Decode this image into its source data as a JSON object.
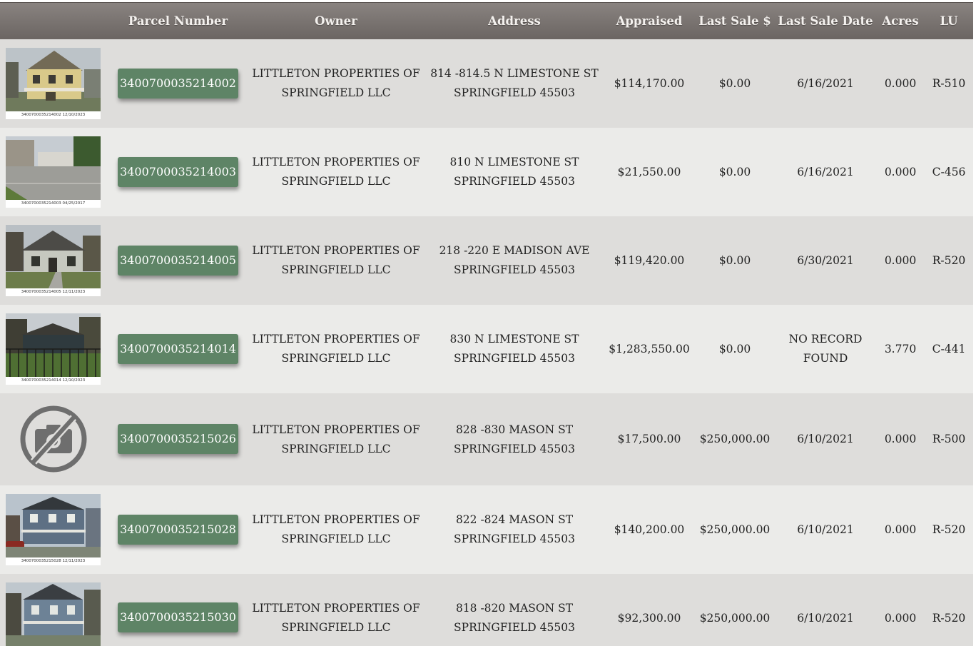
{
  "columns": {
    "parcel": "Parcel Number",
    "owner": "Owner",
    "address": "Address",
    "appraised": "Appraised",
    "last_sale": "Last Sale $",
    "last_sale_date": "Last Sale Date",
    "acres": "Acres",
    "lu": "LU"
  },
  "rows": [
    {
      "photo_caption": "3400700035214002 12/10/2023",
      "parcel": "3400700035214002",
      "owner_line1": "LITTLETON PROPERTIES OF",
      "owner_line2": "SPRINGFIELD LLC",
      "address_line1": "814 -814.5 N LIMESTONE ST",
      "address_line2": "SPRINGFIELD 45503",
      "appraised": "$114,170.00",
      "last_sale": "$0.00",
      "date_line1": "6/16/2021",
      "date_line2": "",
      "acres": "0.000",
      "lu": "R-510"
    },
    {
      "photo_caption": "3400700035214003 04/25/2017",
      "parcel": "3400700035214003",
      "owner_line1": "LITTLETON PROPERTIES OF",
      "owner_line2": "SPRINGFIELD LLC",
      "address_line1": "810 N LIMESTONE ST",
      "address_line2": "SPRINGFIELD 45503",
      "appraised": "$21,550.00",
      "last_sale": "$0.00",
      "date_line1": "6/16/2021",
      "date_line2": "",
      "acres": "0.000",
      "lu": "C-456"
    },
    {
      "photo_caption": "3400700035214005 12/11/2023",
      "parcel": "3400700035214005",
      "owner_line1": "LITTLETON PROPERTIES OF",
      "owner_line2": "SPRINGFIELD LLC",
      "address_line1": "218 -220 E MADISON AVE",
      "address_line2": "SPRINGFIELD 45503",
      "appraised": "$119,420.00",
      "last_sale": "$0.00",
      "date_line1": "6/30/2021",
      "date_line2": "",
      "acres": "0.000",
      "lu": "R-520"
    },
    {
      "photo_caption": "3400700035214014 12/10/2023",
      "parcel": "3400700035214014",
      "owner_line1": "LITTLETON PROPERTIES OF",
      "owner_line2": "SPRINGFIELD LLC",
      "address_line1": "830 N LIMESTONE ST",
      "address_line2": "SPRINGFIELD 45503",
      "appraised": "$1,283,550.00",
      "last_sale": "$0.00",
      "date_line1": "NO RECORD",
      "date_line2": "FOUND",
      "acres": "3.770",
      "lu": "C-441"
    },
    {
      "photo_caption": "",
      "parcel": "3400700035215026",
      "owner_line1": "LITTLETON PROPERTIES OF",
      "owner_line2": "SPRINGFIELD LLC",
      "address_line1": "828 -830 MASON ST",
      "address_line2": "SPRINGFIELD 45503",
      "appraised": "$17,500.00",
      "last_sale": "$250,000.00",
      "date_line1": "6/10/2021",
      "date_line2": "",
      "acres": "0.000",
      "lu": "R-500"
    },
    {
      "photo_caption": "3400700035215028 12/11/2023",
      "parcel": "3400700035215028",
      "owner_line1": "LITTLETON PROPERTIES OF",
      "owner_line2": "SPRINGFIELD LLC",
      "address_line1": "822 -824 MASON ST",
      "address_line2": "SPRINGFIELD 45503",
      "appraised": "$140,200.00",
      "last_sale": "$250,000.00",
      "date_line1": "6/10/2021",
      "date_line2": "",
      "acres": "0.000",
      "lu": "R-520"
    },
    {
      "photo_caption": "",
      "parcel": "3400700035215030",
      "owner_line1": "LITTLETON PROPERTIES OF",
      "owner_line2": "SPRINGFIELD LLC",
      "address_line1": "818 -820 MASON ST",
      "address_line2": "SPRINGFIELD 45503",
      "appraised": "$92,300.00",
      "last_sale": "$250,000.00",
      "date_line1": "6/10/2021",
      "date_line2": "",
      "acres": "0.000",
      "lu": "R-520"
    }
  ],
  "colors": {
    "header": "#7a7471",
    "row_dark": "#dedddb",
    "row_light": "#ebebe9",
    "parcel_button": "#5e8466"
  },
  "icons": {
    "no_photo": "no-photo-camera-icon"
  }
}
